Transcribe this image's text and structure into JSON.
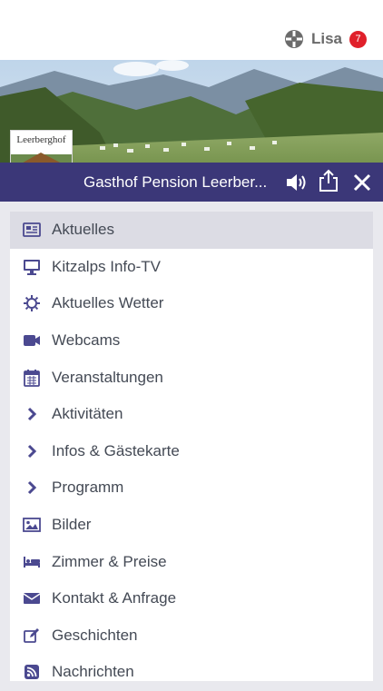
{
  "header": {
    "user_name": "Lisa",
    "notification_count": "7",
    "user_icon": "apps-icon"
  },
  "hero": {
    "thumbnail_text": "Leerberghof"
  },
  "titlebar": {
    "title": "Gasthof Pension Leerber...",
    "icons": [
      "speaker-icon",
      "share-icon",
      "close-icon"
    ]
  },
  "menu": {
    "items": [
      {
        "label": "Aktuelles",
        "icon": "newspaper-icon",
        "active": true
      },
      {
        "label": "Kitzalps Info-TV",
        "icon": "monitor-icon"
      },
      {
        "label": "Aktuelles Wetter",
        "icon": "sun-icon"
      },
      {
        "label": "Webcams",
        "icon": "video-camera-icon"
      },
      {
        "label": "Veranstaltungen",
        "icon": "calendar-icon"
      },
      {
        "label": "Aktivitäten",
        "icon": "chevron-right-icon"
      },
      {
        "label": "Infos & Gästekarte",
        "icon": "chevron-right-icon"
      },
      {
        "label": "Programm",
        "icon": "chevron-right-icon"
      },
      {
        "label": "Bilder",
        "icon": "image-icon"
      },
      {
        "label": "Zimmer & Preise",
        "icon": "bed-icon"
      },
      {
        "label": "Kontakt & Anfrage",
        "icon": "envelope-icon"
      },
      {
        "label": "Geschichten",
        "icon": "edit-icon"
      },
      {
        "label": "Nachrichten",
        "icon": "rss-icon"
      }
    ]
  },
  "colors": {
    "titlebar": "#3b3778",
    "icon": "#4b4990",
    "active_row": "#dcdce4",
    "badge": "#e0202a"
  }
}
